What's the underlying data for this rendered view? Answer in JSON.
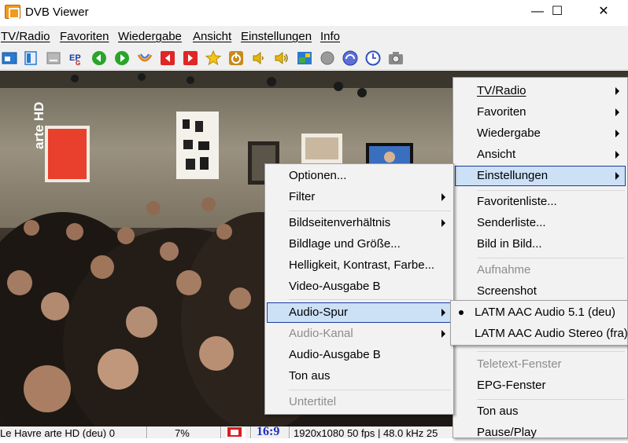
{
  "window": {
    "title": "DVB Viewer",
    "minimize": "—",
    "maximize": "☐",
    "close": "✕"
  },
  "menubar": [
    "TV/Radio",
    "Favoriten",
    "Wiedergabe",
    "Ansicht",
    "Einstellungen",
    "Info"
  ],
  "toolbar_icons": [
    "display-mode-icon",
    "window-icon",
    "minimize-icon",
    "epg-icon",
    "back-icon",
    "forward-icon",
    "record-icon",
    "prev-channel-icon",
    "next-channel-icon",
    "favorites-star-icon",
    "power-icon",
    "volume-down-icon",
    "volume-up-icon",
    "picture-icon",
    "stop-icon",
    "timeshift-icon",
    "clock-icon",
    "snapshot-icon"
  ],
  "video": {
    "channel_logo": "arte HD"
  },
  "statusbar": {
    "channel": "Le Havre arte HD (deu) 0",
    "percent": "7%",
    "aspect": "16:9",
    "format": "1920x1080 50 fps | 48.0 kHz 25"
  },
  "main_menu": [
    {
      "label": "TV/Radio",
      "submenu": true
    },
    {
      "label": "Favoriten",
      "submenu": true
    },
    {
      "label": "Wiedergabe",
      "submenu": true
    },
    {
      "label": "Ansicht",
      "submenu": true
    },
    {
      "label": "Einstellungen",
      "submenu": true,
      "highlighted": true
    },
    {
      "label": "Favoritenliste...",
      "separator_before": true
    },
    {
      "label": "Senderliste..."
    },
    {
      "label": "Bild in Bild..."
    },
    {
      "label": "Aufnahme",
      "disabled": true,
      "separator_before": true
    },
    {
      "label": "Screenshot"
    },
    {
      "label": "Teletext-Fenster",
      "disabled": true,
      "separator_before": true
    },
    {
      "label": "EPG-Fenster"
    },
    {
      "label": "Ton aus",
      "separator_before": true
    },
    {
      "label": "Pause/Play"
    }
  ],
  "settings_menu": [
    {
      "label": "Optionen..."
    },
    {
      "label": "Filter",
      "submenu": true
    },
    {
      "label": "Bildseitenverhältnis",
      "submenu": true,
      "separator_before": true
    },
    {
      "label": "Bildlage und Größe..."
    },
    {
      "label": "Helligkeit, Kontrast, Farbe..."
    },
    {
      "label": "Video-Ausgabe B"
    },
    {
      "label": "Audio-Spur",
      "submenu": true,
      "highlighted": true,
      "separator_before": true
    },
    {
      "label": "Audio-Kanal",
      "submenu": true,
      "disabled": true
    },
    {
      "label": "Audio-Ausgabe B"
    },
    {
      "label": "Ton aus"
    },
    {
      "label": "Untertitel",
      "disabled": true,
      "separator_before": true
    }
  ],
  "audio_menu": [
    {
      "label": "LATM AAC Audio 5.1 (deu)",
      "checked": true
    },
    {
      "label": "LATM AAC Audio Stereo (fra)"
    }
  ]
}
